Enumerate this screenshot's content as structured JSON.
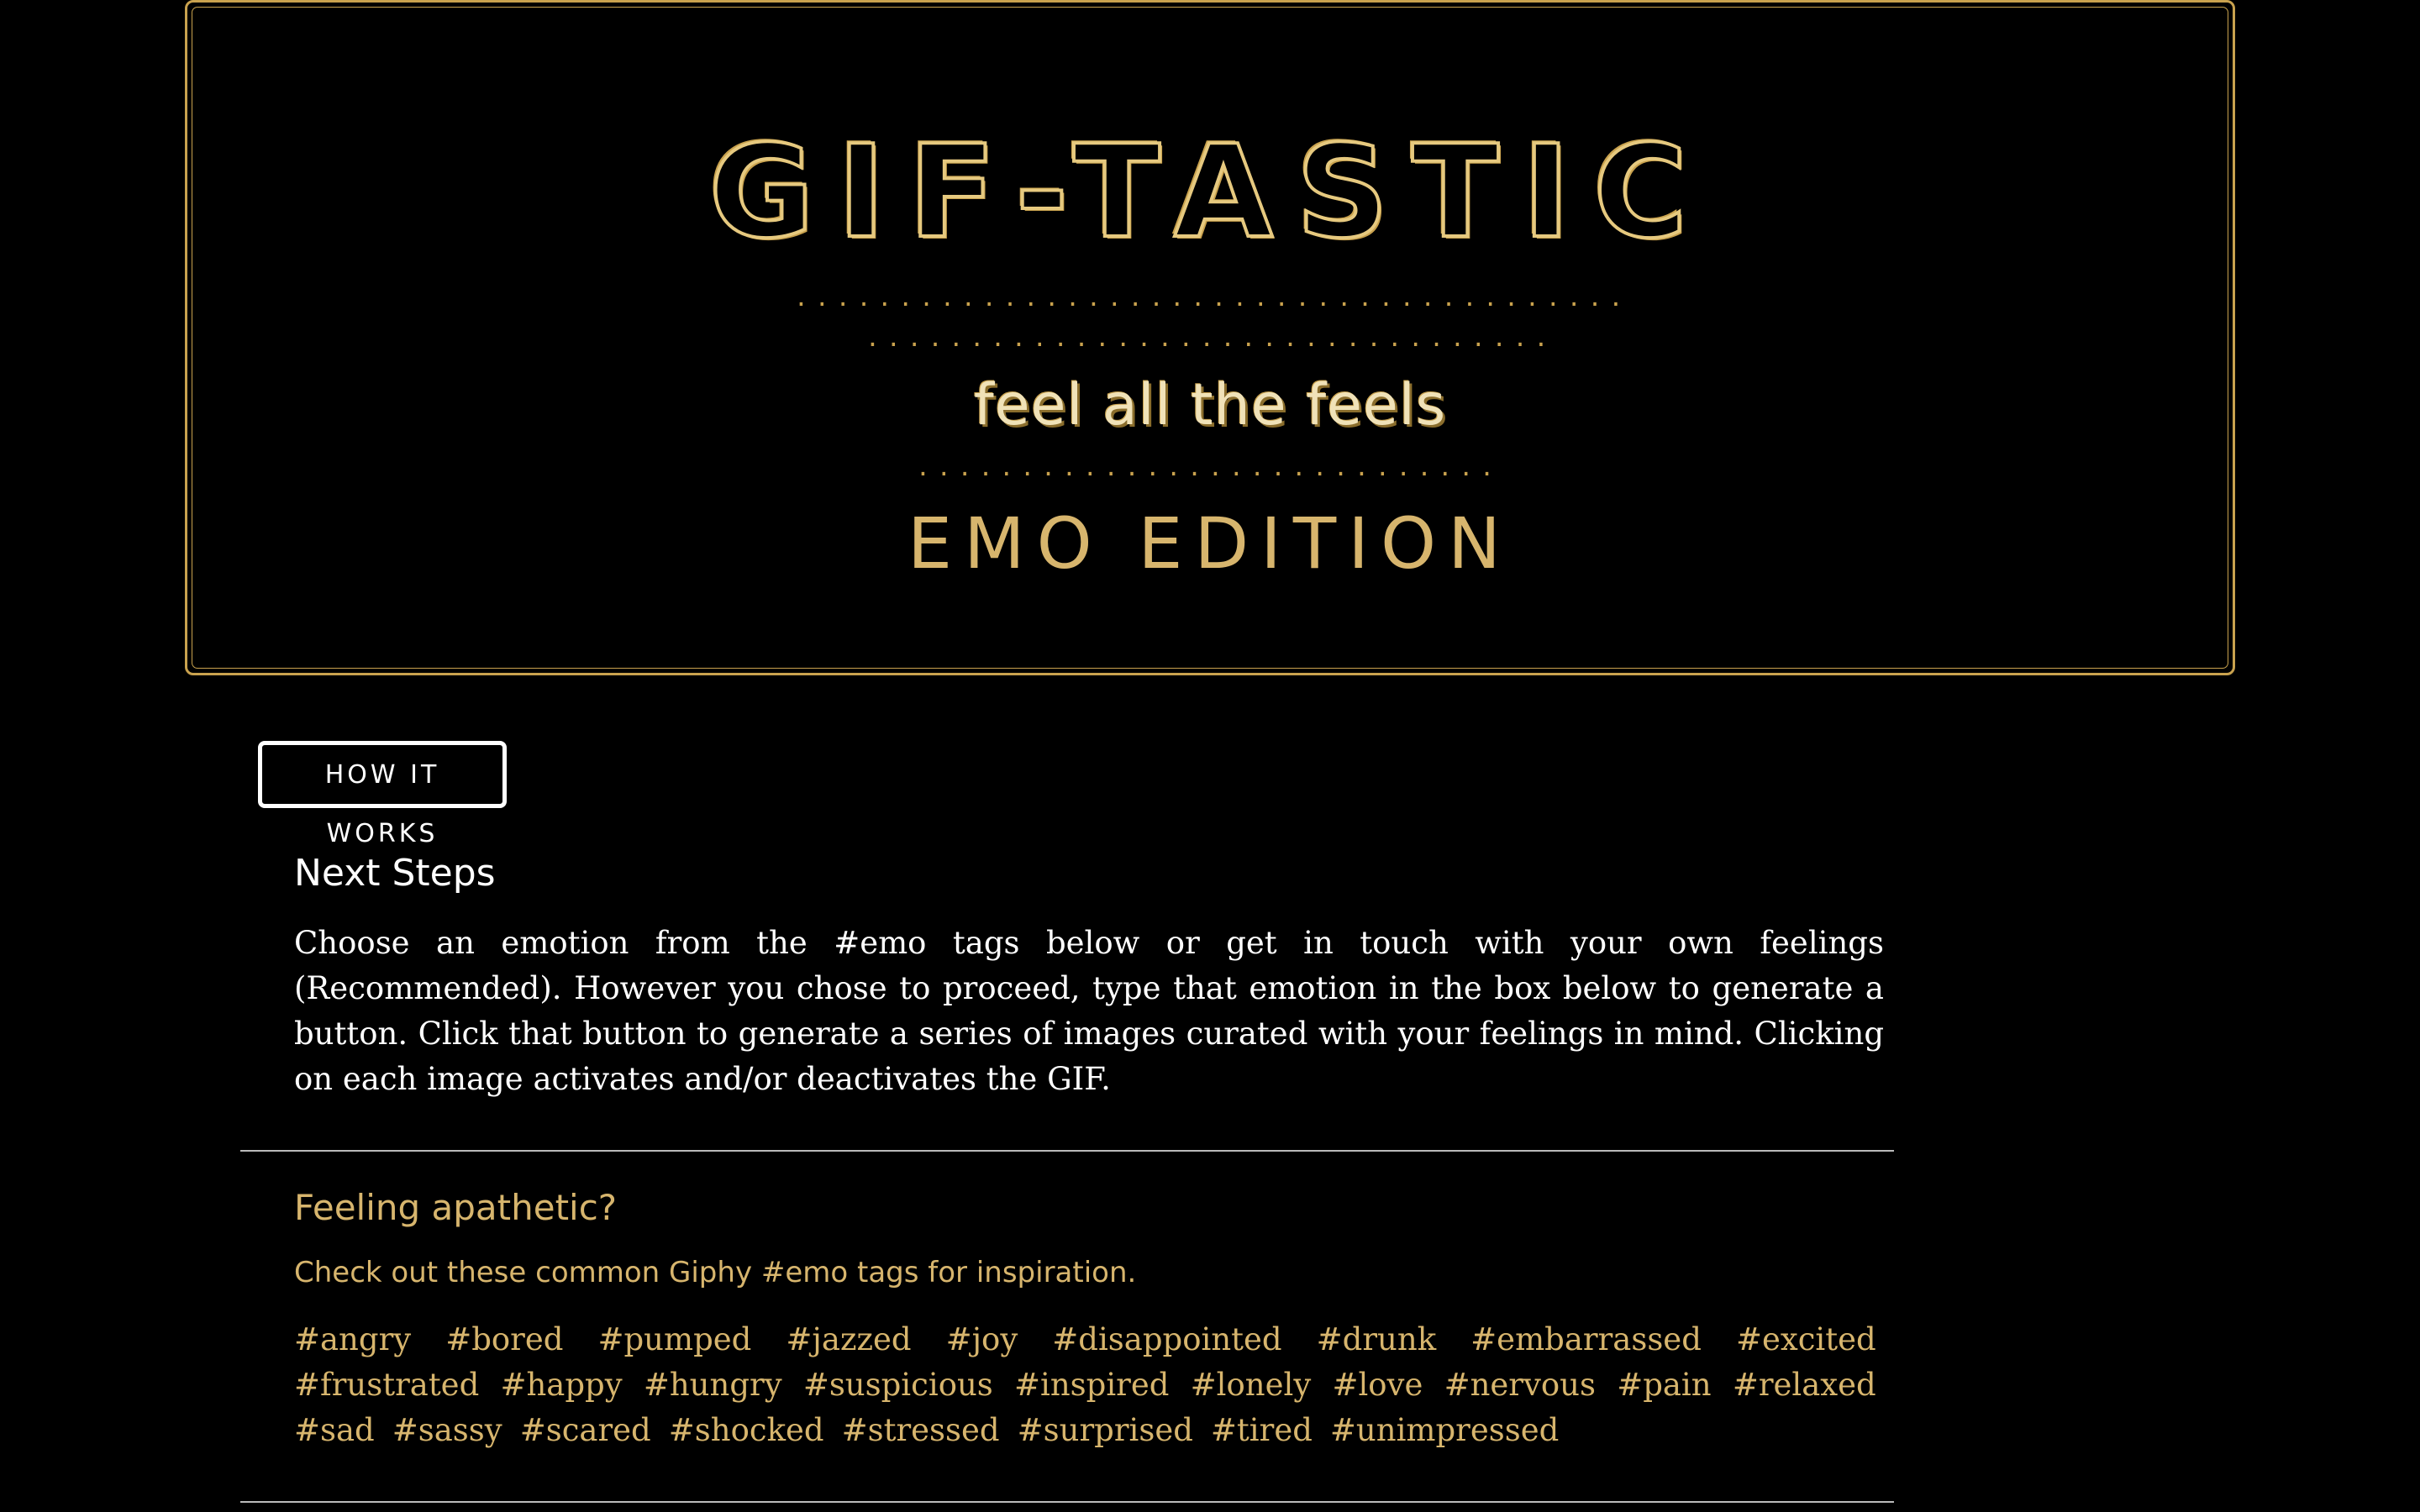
{
  "header": {
    "logo": "GIF-TASTIC",
    "dots_row_1": "..................................................................",
    "dots_row_2": "........................................................",
    "tagline": "feel all the feels",
    "dots_row_3": "................................................",
    "edition": "EMO EDITION"
  },
  "how_it_works": {
    "button_label": "HOW IT WORKS"
  },
  "next_steps": {
    "title": "Next Steps",
    "body": "Choose an emotion from the #emo tags below or get in touch with your own feelings (Recommended). However you chose to proceed, type that emotion in the box below to generate a button. Click that button to generate a series of images curated with your feelings in mind. Clicking on each image activates and/or deactivates the GIF."
  },
  "apathetic": {
    "title": "Feeling apathetic?",
    "subtitle": "Check out these common Giphy #emo tags for inspiration.",
    "tags": [
      "#angry",
      "#bored",
      "#pumped",
      "#jazzed",
      "#joy",
      "#disappointed",
      "#drunk",
      "#embarrassed",
      "#excited",
      "#frustrated",
      "#happy",
      "#hungry",
      "#suspicious",
      "#inspired",
      "#lonely",
      "#love",
      "#nervous",
      "#pain",
      "#relaxed",
      "#sad",
      "#sassy",
      "#scared",
      "#shocked",
      "#stressed",
      "#surprised",
      "#tired",
      "#unimpressed"
    ]
  },
  "colors": {
    "background": "#000000",
    "gold": "#c9a24e",
    "gold_text": "#d7b56d",
    "white": "#ffffff"
  }
}
